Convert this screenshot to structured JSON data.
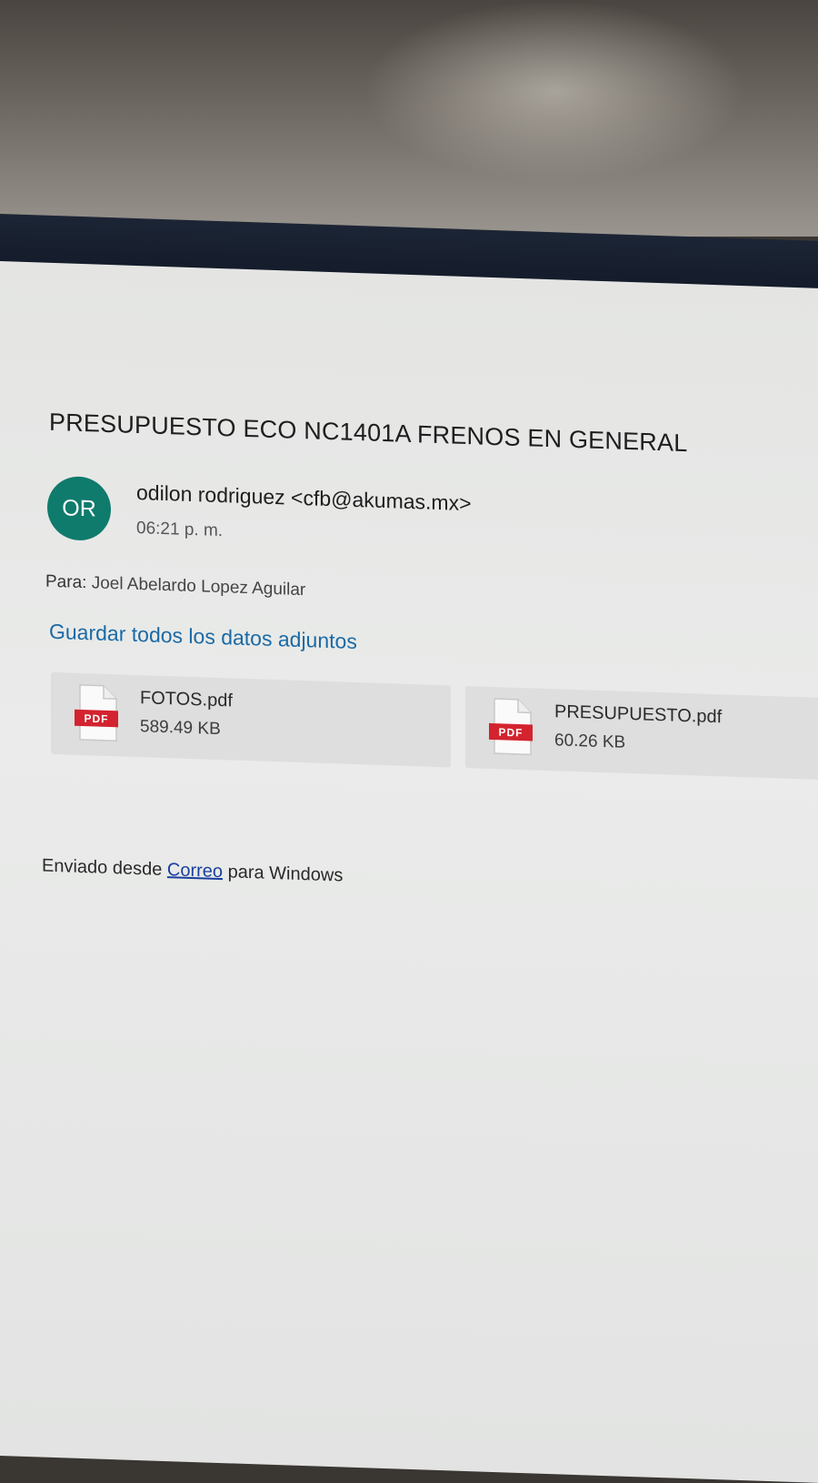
{
  "email": {
    "subject": "PRESUPUESTO ECO NC1401A FRENOS EN GENERAL",
    "sender": {
      "initials": "OR",
      "display": "odilon rodriguez <cfb@akumas.mx>",
      "avatar_color": "#0f7b6c"
    },
    "time": "06:21 p. m.",
    "to_label": "Para:",
    "to_name": "Joel Abelardo Lopez Aguilar",
    "save_all_label": "Guardar todos los datos adjuntos",
    "attachments": [
      {
        "icon": "pdf-file-icon",
        "badge": "PDF",
        "name": "FOTOS.pdf",
        "size": "589.49 KB"
      },
      {
        "icon": "pdf-file-icon",
        "badge": "PDF",
        "name": "PRESUPUESTO.pdf",
        "size": "60.26 KB"
      }
    ],
    "signature": {
      "prefix": "Enviado desde",
      "link": "Correo",
      "suffix": "para Windows"
    }
  },
  "colors": {
    "accent_link": "#1b6aa5",
    "pdf_badge": "#d3232f"
  }
}
